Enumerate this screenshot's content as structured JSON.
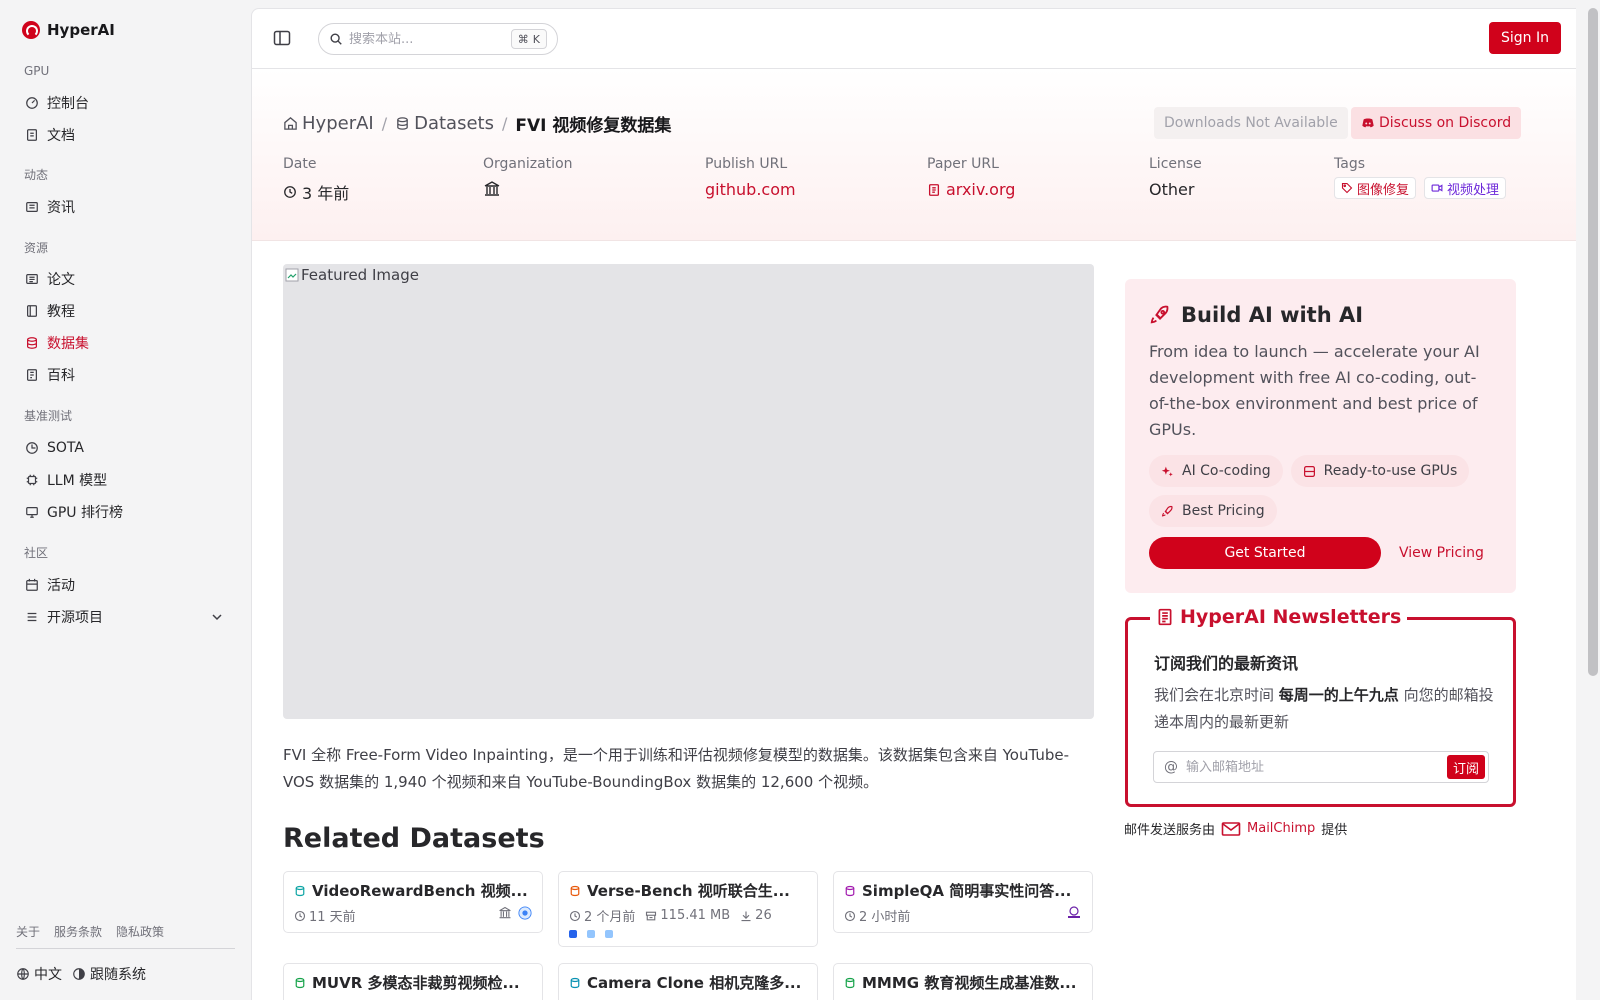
{
  "app": {
    "name": "HyperAI",
    "accent": "#d0021b"
  },
  "sidebar": {
    "sections": [
      {
        "label": "GPU",
        "items": [
          {
            "label": "控制台",
            "icon": "gauge-icon"
          },
          {
            "label": "文档",
            "icon": "doc-icon"
          }
        ]
      },
      {
        "label": "动态",
        "items": [
          {
            "label": "资讯",
            "icon": "news-icon"
          }
        ]
      },
      {
        "label": "资源",
        "items": [
          {
            "label": "论文",
            "icon": "paper-icon"
          },
          {
            "label": "教程",
            "icon": "book-icon"
          },
          {
            "label": "数据集",
            "icon": "database-icon",
            "active": true
          },
          {
            "label": "百科",
            "icon": "wiki-icon"
          }
        ]
      },
      {
        "label": "基准测试",
        "items": [
          {
            "label": "SOTA",
            "icon": "chart-icon"
          },
          {
            "label": "LLM 模型",
            "icon": "cpu-icon"
          },
          {
            "label": "GPU 排行榜",
            "icon": "monitor-icon"
          }
        ]
      },
      {
        "label": "社区",
        "items": [
          {
            "label": "活动",
            "icon": "calendar-icon"
          },
          {
            "label": "开源项目",
            "icon": "list-icon"
          }
        ]
      }
    ],
    "footer_links": [
      "关于",
      "服务条款",
      "隐私政策"
    ],
    "language": "中文",
    "theme": "跟随系统"
  },
  "topbar": {
    "search_placeholder": "搜索本站...",
    "shortcut": "K",
    "signin": "Sign In"
  },
  "hero": {
    "breadcrumb": [
      "HyperAI",
      "Datasets",
      "FVI 视频修复数据集"
    ],
    "downloads": "Downloads Not Available",
    "discord": "Discuss on Discord",
    "meta": {
      "date_label": "Date",
      "date_value": "3 年前",
      "org_label": "Organization",
      "publish_label": "Publish URL",
      "publish_value": "github.com",
      "paper_label": "Paper URL",
      "paper_value": "arxiv.org",
      "license_label": "License",
      "license_value": "Other",
      "tags_label": "Tags",
      "tags": [
        "图像修复",
        "视频处理"
      ]
    }
  },
  "featured_alt": "Featured Image",
  "description": "FVI 全称 Free-Form Video Inpainting，是一个用于训练和评估视频修复模型的数据集。该数据集包含来自 YouTube-VOS 数据集的 1,940 个视频和来自 YouTube-BoundingBox 数据集的 12,600 个视频。",
  "related": {
    "title": "Related Datasets",
    "cards": [
      {
        "title": "VideoRewardBench 视频...",
        "time": "11 天前"
      },
      {
        "title": "Verse-Bench 视听联合生...",
        "time": "2 个月前",
        "size": "115.41 MB",
        "downloads": "26"
      },
      {
        "title": "SimpleQA 简明事实性问答...",
        "time": "2 小时前"
      },
      {
        "title": "MUVR 多模态非裁剪视频检..."
      },
      {
        "title": "Camera Clone 相机克隆多..."
      },
      {
        "title": "MMMG 教育视频生成基准数..."
      }
    ]
  },
  "promo": {
    "title": "Build AI with AI",
    "text": "From idea to launch — accelerate your AI development with free AI co-coding, out-of-the-box environment and best price of GPUs.",
    "chips": [
      "AI Co-coding",
      "Ready-to-use GPUs",
      "Best Pricing"
    ],
    "start": "Get Started",
    "pricing": "View Pricing"
  },
  "newsletter": {
    "title": "HyperAI Newsletters",
    "heading": "订阅我们的最新资讯",
    "text_before": "我们会在北京时间",
    "text_bold": "每周一的上午九点",
    "text_after": "向您的邮箱投递本周内的最新更新",
    "placeholder": "输入邮箱地址",
    "subscribe": "订阅",
    "provider_before": "邮件发送服务由",
    "provider": "MailChimp",
    "provider_after": "提供"
  }
}
